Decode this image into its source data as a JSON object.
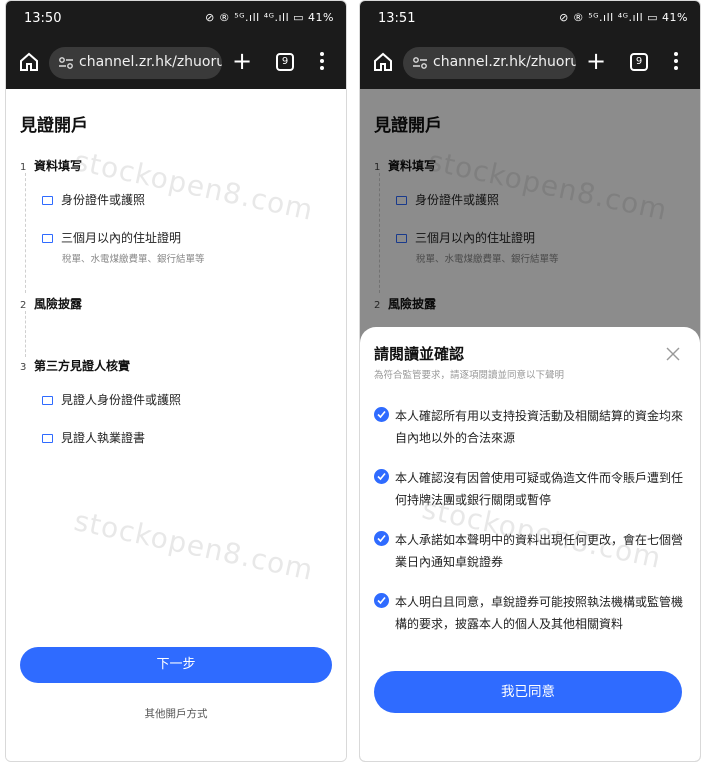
{
  "left_screen": {
    "status_time": "13:50",
    "status_icons": "⊘ ® ⁵ᴳ.ıll ⁴ᴳ.ıll ▭ 41%",
    "url": "channel.zr.hk/zhuorui_\\",
    "tab_count": "9",
    "title": "見證開戶",
    "steps": [
      {
        "num": "1",
        "label": "資料填写"
      },
      {
        "num": "2",
        "label": "風險披露"
      },
      {
        "num": "3",
        "label": "第三方見證人核實"
      }
    ],
    "items": [
      {
        "label": "身份證件或護照",
        "icon": "id-card-icon"
      },
      {
        "label": "三個月以內的住址證明",
        "icon": "document-icon"
      },
      {
        "label": "見證人身份證件或護照",
        "icon": "id-card-icon"
      },
      {
        "label": "見證人執業證書",
        "icon": "certificate-icon"
      }
    ],
    "address_sub": "稅單、水電煤繳費單、銀行結單等",
    "watermark": "stockopen8.com",
    "next_label": "下一步",
    "other_label": "其他開戶方式"
  },
  "right_screen": {
    "status_time": "13:51",
    "status_icons": "⊘ ® ⁵ᴳ.ıll ⁴ᴳ.ıll ▭ 41%",
    "url": "channel.zr.hk/zhuorui_\\",
    "tab_count": "9",
    "title": "見證開戶",
    "steps": [
      {
        "num": "1",
        "label": "資料填写"
      },
      {
        "num": "2",
        "label": "風險披露"
      }
    ],
    "items": [
      {
        "label": "身份證件或護照",
        "icon": "id-card-icon"
      },
      {
        "label": "三個月以內的住址證明",
        "icon": "document-icon"
      }
    ],
    "address_sub": "稅單、水電煤繳費單、銀行結單等",
    "watermark": "stockopen8.com",
    "sheet": {
      "title": "請閱讀並確認",
      "subtitle": "為符合監管要求，請逐項閱讀並同意以下聲明",
      "clauses": [
        "本人確認所有用以支持投資活動及相關結算的資金均來自內地以外的合法來源",
        "本人確認沒有因曾使用可疑或偽造文件而令賬戶遭到任何持牌法團或銀行關閉或暫停",
        "本人承諾如本聲明中的資料出現任何更改，會在七個營業日內通知卓銳證券",
        "本人明白且同意，卓銳證券可能按照執法機構或監管機構的要求，披露本人的個人及其他相關資料"
      ],
      "agree_label": "我已同意"
    }
  },
  "colors": {
    "accent": "#2f6bff",
    "chrome_bg": "#1b1b1b",
    "url_bg": "#3a3a3a"
  }
}
